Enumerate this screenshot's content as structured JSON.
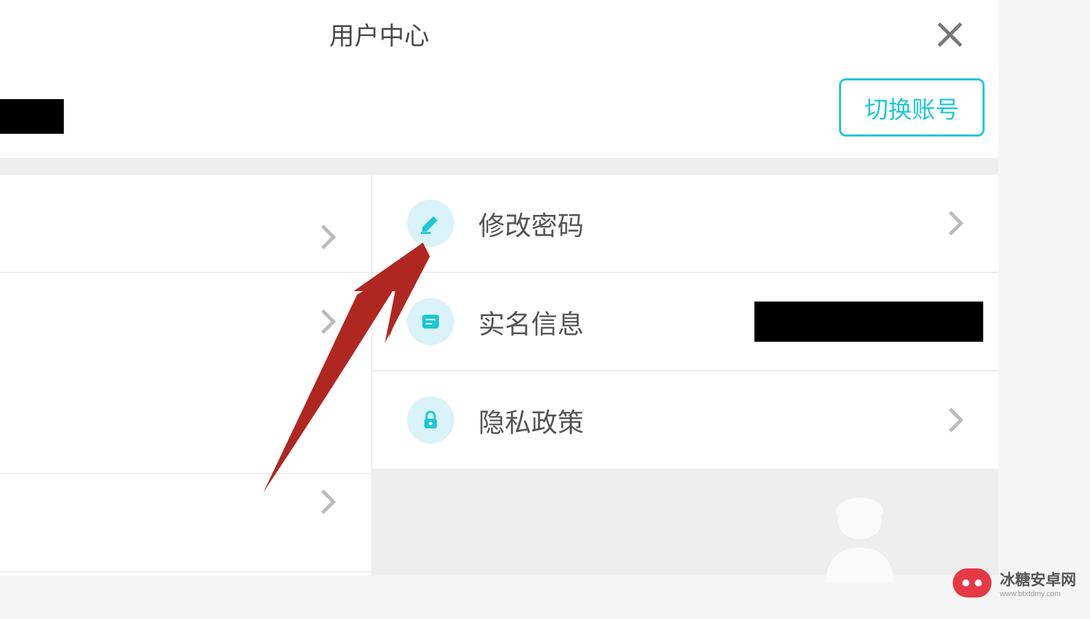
{
  "header": {
    "title": "用户中心"
  },
  "account": {
    "switch_label": "切换账号"
  },
  "menu": {
    "change_password": "修改密码",
    "real_name_info": "实名信息",
    "privacy_policy": "隐私政策"
  },
  "watermark": {
    "title": "冰糖安卓网",
    "sub": "www.btxtdmy.com"
  },
  "colors": {
    "accent": "#1dc7d6",
    "arrow": "#b02722"
  }
}
